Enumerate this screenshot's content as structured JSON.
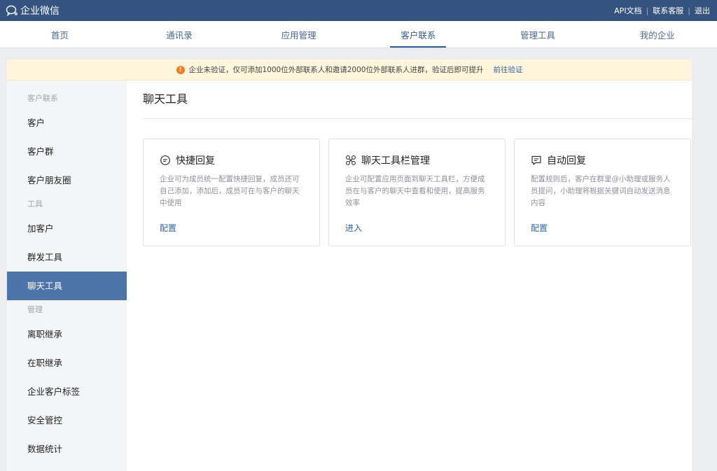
{
  "app": {
    "title": "企业微信"
  },
  "top_links": [
    "API文档",
    "联系客服",
    "退出"
  ],
  "nav": {
    "tabs": [
      "首页",
      "通讯录",
      "应用管理",
      "客户联系",
      "管理工具",
      "我的企业"
    ]
  },
  "notice": {
    "text": "企业未验证，仅可添加1000位外部联系人和邀请2000位外部联系人进群，验证后即可提升",
    "link": "前往验证"
  },
  "sidebar": {
    "groups": [
      {
        "title": "客户联系",
        "items": [
          "客户",
          "客户群",
          "客户朋友圈"
        ]
      },
      {
        "title": "工具",
        "items": [
          "加客户",
          "群发工具",
          "聊天工具"
        ]
      },
      {
        "title": "管理",
        "items": [
          "离职继承",
          "在职继承",
          "企业客户标签",
          "安全管控",
          "数据统计"
        ]
      }
    ]
  },
  "main": {
    "title": "聊天工具",
    "cards": [
      {
        "icon": "quick-reply-icon",
        "title": "快捷回复",
        "desc": "企业可为成员统一配置快捷回复，成员还可自己添加，添加后，成员可在与客户的聊天中使用",
        "action": "配置"
      },
      {
        "icon": "toolbar-icon",
        "title": "聊天工具栏管理",
        "desc": "企业可配置应用页面到聊天工具栏，方便成员在与客户的聊天中查看和使用，提高服务效率",
        "action": "进入"
      },
      {
        "icon": "auto-reply-icon",
        "title": "自动回复",
        "desc": "配置规则后，客户在群里@小助理或服务人员提问，小助理将根据关键词自动发送消息内容",
        "action": "配置"
      }
    ]
  },
  "colors": {
    "topbar": "#34537f",
    "accent": "#2f5e96",
    "sidebar_active": "#4d74a9",
    "notice_bg": "#fdf6dc"
  }
}
